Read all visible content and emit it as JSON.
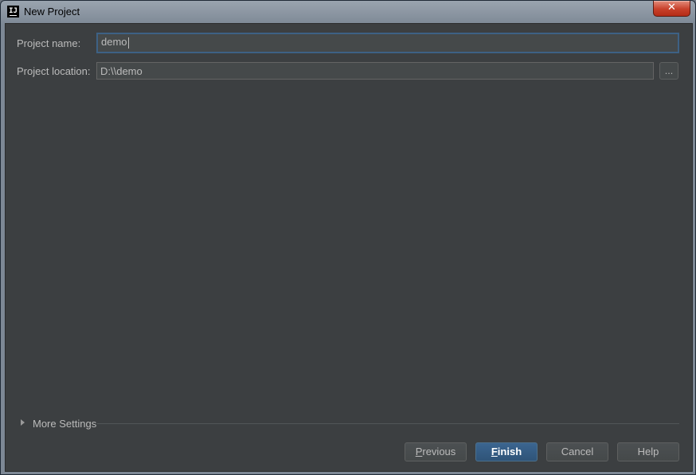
{
  "window": {
    "title": "New Project",
    "app_icon_text": "IJ",
    "close_glyph": "✕"
  },
  "form": {
    "project_name": {
      "label": "Project name:",
      "value": "demo"
    },
    "project_location": {
      "label": "Project location:",
      "value": "D:\\\\demo",
      "browse_label": "..."
    }
  },
  "more_settings": {
    "label": "More Settings"
  },
  "buttons": {
    "previous": "Previous",
    "finish": "Finish",
    "cancel": "Cancel",
    "help": "Help"
  },
  "colors": {
    "background": "#3c3f41",
    "field": "#45494a",
    "focus_border": "#3d6185",
    "default_button": "#365880",
    "text": "#bbbbbb",
    "close_button": "#c8402a"
  },
  "icons": {
    "app": "intellij-idea-icon",
    "close": "close-icon",
    "expand": "triangle-right-icon"
  }
}
